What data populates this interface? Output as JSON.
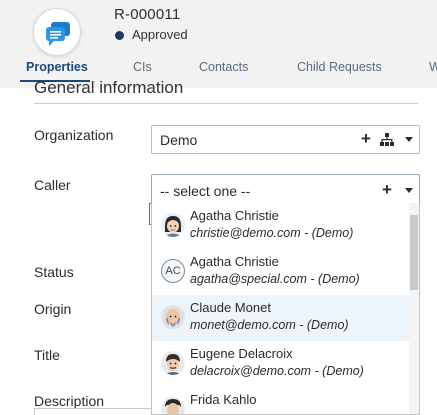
{
  "header": {
    "reference": "R-000011",
    "status": "Approved",
    "app_icon": "chat-bubble-icon",
    "status_color": "#1b3a5c"
  },
  "tabs": [
    {
      "label": "Properties",
      "active": true
    },
    {
      "label": "CIs",
      "active": false
    },
    {
      "label": "Contacts",
      "active": false
    },
    {
      "label": "Child Requests",
      "active": false
    },
    {
      "label": "W",
      "active": false
    }
  ],
  "section": {
    "title": "General information"
  },
  "form": {
    "organization_label": "Organization",
    "organization_value": "Demo",
    "caller_label": "Caller",
    "caller_placeholder": "-- select one --",
    "status_label": "Status",
    "origin_label": "Origin",
    "title_label": "Title",
    "description_label": "Description"
  },
  "caller_options": [
    {
      "name": "Agatha Christie",
      "sub": "christie@demo.com - (Demo)",
      "avatar": "avatar-female-icon",
      "hover": false
    },
    {
      "name": "Agatha Christie",
      "sub": "agatha@special.com - (Demo)",
      "avatar": "initials",
      "initials": "AC",
      "hover": false
    },
    {
      "name": "Claude Monet",
      "sub": "monet@demo.com - (Demo)",
      "avatar": "avatar-bald-man-icon",
      "hover": true
    },
    {
      "name": "Eugene Delacroix",
      "sub": "delacroix@demo.com - (Demo)",
      "avatar": "avatar-man-icon",
      "hover": false
    },
    {
      "name": "Frida Kahlo",
      "sub": "",
      "avatar": "avatar-female-icon",
      "hover": false
    }
  ],
  "colors": {
    "accent": "#1b4a7a",
    "hover_row": "#eef5fa"
  }
}
